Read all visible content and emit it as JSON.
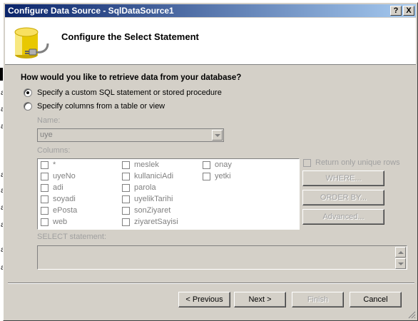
{
  "window": {
    "title": "Configure Data Source - SqlDataSource1",
    "help_label": "?",
    "close_label": "X"
  },
  "header": {
    "title": "Configure the Select Statement",
    "icon": "database-icon"
  },
  "question": "How would you like to retrieve data from your database?",
  "options": {
    "custom_sql": "Specify a custom SQL statement or stored procedure",
    "columns": "Specify columns from a table or view"
  },
  "name_section": {
    "label": "Name:",
    "selected": "uye"
  },
  "columns_section": {
    "label": "Columns:",
    "items": [
      "*",
      "uyeNo",
      "adi",
      "soyadi",
      "ePosta",
      "web",
      "meslek",
      "kullaniciAdi",
      "parola",
      "uyelikTarihi",
      "sonZiyaret",
      "ziyaretSayisi",
      "onay",
      "yetki"
    ]
  },
  "side_buttons": {
    "unique_label": "Return only unique rows",
    "where": "WHERE...",
    "order_by": "ORDER BY...",
    "advanced": "Advanced..."
  },
  "select_statement": {
    "label": "SELECT statement:",
    "value": ""
  },
  "footer": {
    "previous": "< Previous",
    "next": "Next >",
    "finish": "Finish",
    "cancel": "Cancel"
  },
  "colors": {
    "dialog_bg": "#d4d0c8",
    "titlebar_start": "#0a246a",
    "titlebar_end": "#a6caf0"
  }
}
